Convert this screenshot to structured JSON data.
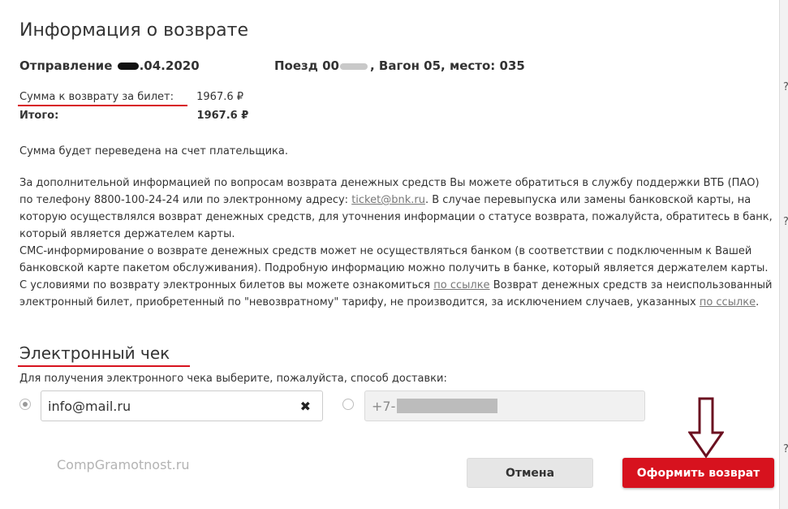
{
  "modal": {
    "title": "Информация о возврате",
    "departure_label": "Отправление",
    "departure_date_suffix": ".04.2020",
    "train_prefix": "Поезд 00",
    "train_rest": ", Вагон 05, место: 035",
    "refund_label": "Сумма к возврату за билет:",
    "refund_value": "1967.6 ₽",
    "total_label": "Итого:",
    "total_value": "1967.6 ₽",
    "transfer_note": "Сумма будет переведена на счет плательщика.",
    "info_part1": "За дополнительной информацией по вопросам возврата денежных средств Вы можете обратиться в службу поддержки ВТБ (ПАО) по телефону 8800-100-24-24 или по электронному адресу: ",
    "info_email_link": "ticket@bnk.ru",
    "info_part2": ". В случае перевыпуска или замены банковской карты, на которую осуществлялся возврат денежных средств, для уточнения информации о статусе возврата, пожалуйста, обратитесь в банк, который является держателем карты.",
    "info_part3": "СМС-информирование о возврате денежных средств может не осуществляться банком (в соответствии с подключенным к Вашей банковской карте пакетом обслуживания). Подробную информацию можно получить в банке, который является держателем карты. С условиями по возврату электронных билетов вы можете ознакомиться ",
    "link_label_1": "по ссылке",
    "info_part4": " Возврат денежных средств за неиспользованный электронный билет, приобретенный по \"невозвратному\" тарифу, не производится, за исключением случаев, указанных ",
    "link_label_2": "по ссылке",
    "info_part5": ".",
    "receipt_title": "Электронный чек",
    "receipt_hint": "Для получения электронного чека выберите, пожалуйста, способ доставки:",
    "email_value": "info@mail.ru",
    "phone_prefix": "+7-",
    "cancel_label": "Отмена",
    "submit_label": "Оформить возврат"
  },
  "overlay": {
    "watermark": "CompGramotnost.ru"
  },
  "background_page": {
    "fragment_1": "?",
    "fragment_2": "?",
    "fragment_3": "?"
  },
  "colors": {
    "accent_red": "#d7121e",
    "annotation_arrow": "#6b1020"
  },
  "icons": {
    "clear": "close-icon",
    "annotation": "down-arrow-icon"
  }
}
